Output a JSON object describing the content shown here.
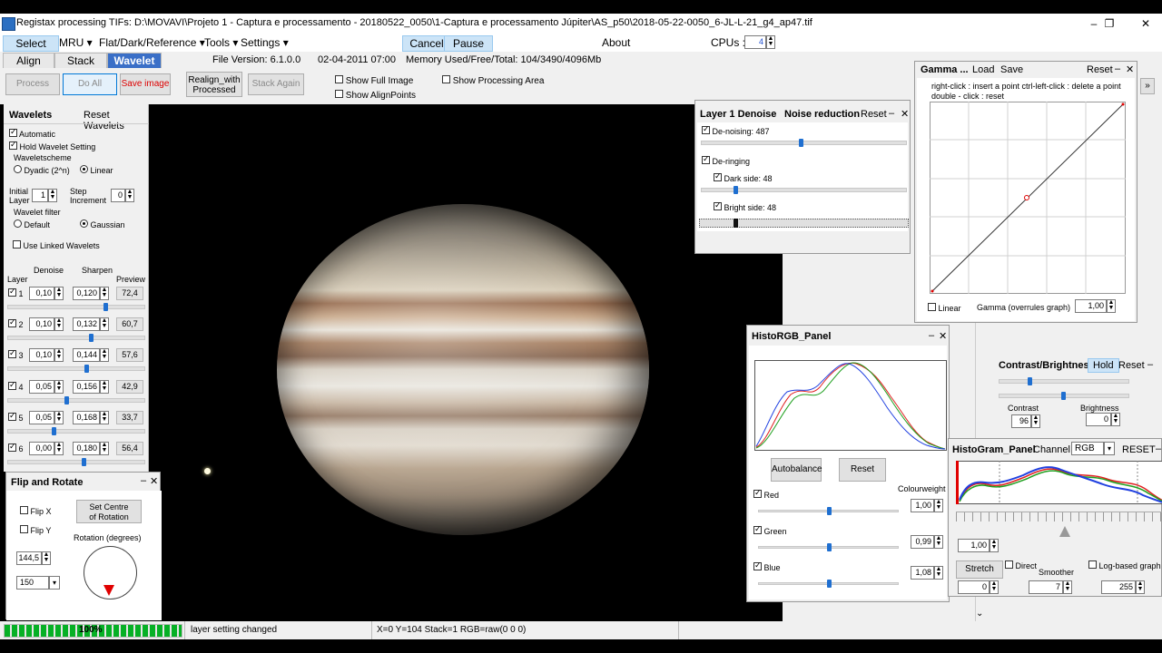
{
  "window": {
    "title": "Registax processing TIFs: D:\\MOVAVI\\Projeto 1 - Captura e processamento - 20180522_0050\\1-Captura e processamento Júpiter\\AS_p50\\2018-05-22-0050_6-JL-L-21_g4_ap47.tif",
    "minimize": "–",
    "maximize": "❐",
    "close": "✕"
  },
  "menubar": {
    "select": "Select",
    "mru": "MRU ▾",
    "flat": "Flat/Dark/Reference ▾",
    "tools": "Tools ▾",
    "settings": "Settings ▾",
    "cancel": "Cancel",
    "pause": "Pause",
    "about": "About",
    "cpus_label": "CPUs :",
    "cpus_value": "4"
  },
  "tabs": {
    "align": "Align",
    "stack": "Stack",
    "wavelet": "Wavelet"
  },
  "info": {
    "file_version": "File Version: 6.1.0.0",
    "date": "02-04-2011 07:00",
    "memory": "Memory Used/Free/Total: 104/3490/4096Mb"
  },
  "toolbar": {
    "process": "Process",
    "do_all": "Do All",
    "save_image": "Save image",
    "realign_1": "Realign_with",
    "realign_2": "Processed",
    "stack_again": "Stack Again",
    "show_full_image": "Show Full Image",
    "show_alignpoints": "Show AlignPoints",
    "show_processing_area": "Show Processing Area"
  },
  "wavelets": {
    "title": "Wavelets",
    "reset": "Reset Wavelets",
    "automatic": "Automatic",
    "hold": "Hold Wavelet Setting",
    "scheme_label": "Waveletscheme",
    "dyadic": "Dyadic (2^n)",
    "linear": "Linear",
    "initial_layer_1": "Initial",
    "initial_layer_2": "Layer",
    "initial_layer_value": "1",
    "step_1": "Step",
    "step_2": "Increment",
    "step_value": "0",
    "filter_label": "Wavelet filter",
    "default": "Default",
    "gaussian": "Gaussian",
    "linked": "Use Linked Wavelets",
    "col_layer": "Layer",
    "col_denoise": "Denoise",
    "col_sharpen": "Sharpen",
    "col_preview": "Preview",
    "layers": [
      {
        "num": "1",
        "denoise": "0,10",
        "sharpen": "0,120",
        "preview": "72,4",
        "slider": 0.72
      },
      {
        "num": "2",
        "denoise": "0,10",
        "sharpen": "0,132",
        "preview": "60,7",
        "slider": 0.61
      },
      {
        "num": "3",
        "denoise": "0,10",
        "sharpen": "0,144",
        "preview": "57,6",
        "slider": 0.58
      },
      {
        "num": "4",
        "denoise": "0,05",
        "sharpen": "0,156",
        "preview": "42,9",
        "slider": 0.43
      },
      {
        "num": "5",
        "denoise": "0,05",
        "sharpen": "0,168",
        "preview": "33,7",
        "slider": 0.34
      },
      {
        "num": "6",
        "denoise": "0,00",
        "sharpen": "0,180",
        "preview": "56,4",
        "slider": 0.56
      }
    ]
  },
  "flip": {
    "title": "Flip and Rotate",
    "flip_x": "Flip X",
    "flip_y": "Flip Y",
    "set_centre_1": "Set Centre",
    "set_centre_2": "of Rotation",
    "rotation_label": "Rotation (degrees)",
    "rotation_value": "144,5",
    "size_value": "150",
    "minimize": "–",
    "close": "✕"
  },
  "denoise": {
    "title": "Layer 1 Denoise",
    "subtitle": "Noise reduction",
    "reset": "Reset",
    "denoising": "De-noising: 487",
    "denoising_level": 0.49,
    "deringing": "De-ringing",
    "dark": "Dark side: 48",
    "dark_level": 0.17,
    "bright": "Bright side: 48",
    "bright_level": 0.17,
    "minimize": "–",
    "close": "✕"
  },
  "gamma": {
    "title": "Gamma ...",
    "load": "Load",
    "save": "Save",
    "reset": "Reset",
    "hint1": "right-click : insert a point   ctrl-left-click : delete a point",
    "hint2": "double - click : reset",
    "linear": "Linear",
    "gamma_label": "Gamma (overrules graph)",
    "gamma_value": "1,00",
    "minimize": "–",
    "close": "✕"
  },
  "histo_rgb": {
    "title": "HistoRGB_Panel",
    "autobalance": "Autobalance",
    "reset": "Reset",
    "colourweight": "Colourweight",
    "red": "Red",
    "red_value": "1,00",
    "red_level": 0.5,
    "green": "Green",
    "green_value": "0,99",
    "green_level": 0.5,
    "blue": "Blue",
    "blue_value": "1,08",
    "blue_level": 0.5,
    "minimize": "–",
    "close": "✕",
    "colors": {
      "red": "#e02020",
      "green": "#20a020",
      "blue": "#2040e0"
    }
  },
  "contrast": {
    "title": "Contrast/Brightness",
    "hold": "Hold",
    "reset": "Reset",
    "contrast_label": "Contrast",
    "contrast_value": "96",
    "contrast_level": 0.24,
    "brightness_label": "Brightness",
    "brightness_value": "0",
    "brightness_level": 0.5,
    "minimize": "–"
  },
  "histogram": {
    "title": "HistoGram_Panel",
    "channel_label": "Channel",
    "channel_value": "RGB",
    "reset": "RESET",
    "value": "1,00",
    "stretch": "Stretch",
    "direct": "Direct",
    "smoother": "Smoother",
    "log": "Log-based graph",
    "low": "0",
    "smooth_value": "7",
    "high": "255",
    "minimize": "–"
  },
  "status": {
    "progress": "100%",
    "progress_level": 1.0,
    "message": "layer setting changed",
    "coords": "X=0 Y=104 Stack=1 RGB=raw(0 0 0)"
  }
}
